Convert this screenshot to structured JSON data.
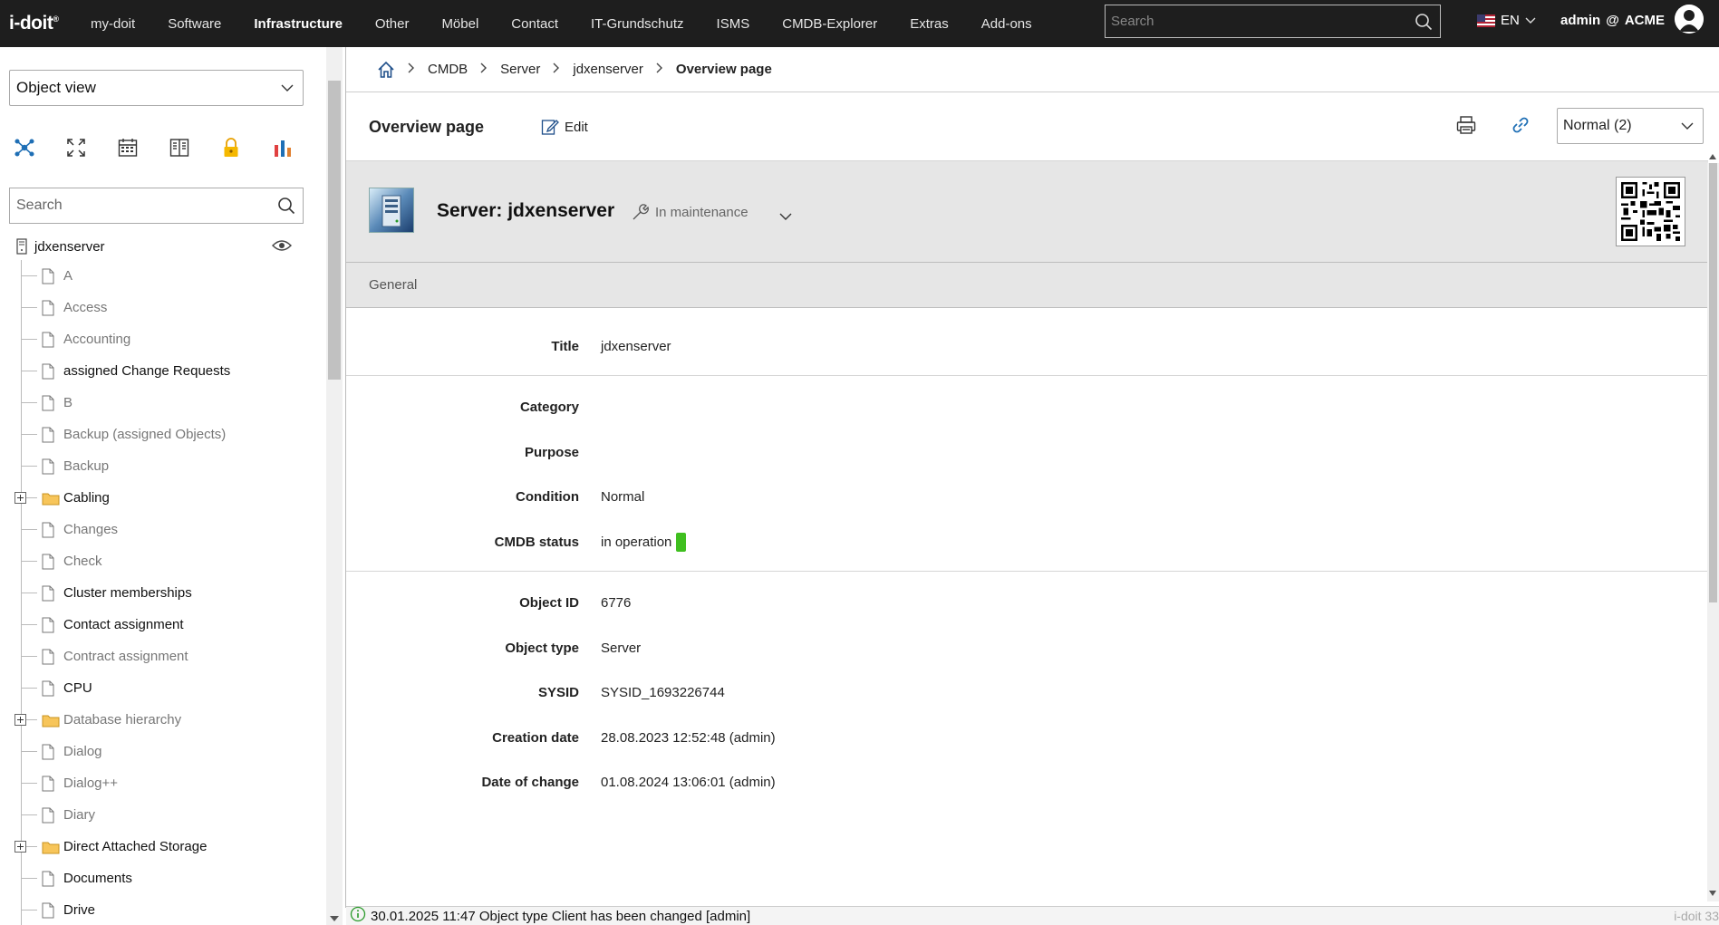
{
  "app": {
    "logo": "i-doit",
    "logo_mark": "®"
  },
  "topnav": {
    "items": [
      {
        "label": "my-doit",
        "active": false
      },
      {
        "label": "Software",
        "active": false
      },
      {
        "label": "Infrastructure",
        "active": true
      },
      {
        "label": "Other",
        "active": false
      },
      {
        "label": "Möbel",
        "active": false
      },
      {
        "label": "Contact",
        "active": false
      },
      {
        "label": "IT-Grundschutz",
        "active": false
      },
      {
        "label": "ISMS",
        "active": false
      },
      {
        "label": "CMDB-Explorer",
        "active": false
      },
      {
        "label": "Extras",
        "active": false
      },
      {
        "label": "Add-ons",
        "active": false
      }
    ],
    "search_placeholder": "Search",
    "language": "EN",
    "user": "admin",
    "user_sep": "@",
    "tenant": "ACME"
  },
  "sidebar": {
    "view_select": "Object view",
    "search_placeholder": "Search",
    "tools": [
      "network-icon",
      "expand-icon",
      "calendar-icon",
      "book-icon",
      "lock-icon",
      "bar-chart-icon"
    ],
    "root": "jdxenserver",
    "items": [
      {
        "label": "A",
        "type": "file",
        "muted": true
      },
      {
        "label": "Access",
        "type": "file",
        "muted": true
      },
      {
        "label": "Accounting",
        "type": "file",
        "muted": true
      },
      {
        "label": "assigned Change Requests",
        "type": "file",
        "muted": false
      },
      {
        "label": "B",
        "type": "file",
        "muted": true
      },
      {
        "label": "Backup (assigned Objects)",
        "type": "file",
        "muted": true
      },
      {
        "label": "Backup",
        "type": "file",
        "muted": true
      },
      {
        "label": "Cabling",
        "type": "folder",
        "muted": false
      },
      {
        "label": "Changes",
        "type": "file",
        "muted": true
      },
      {
        "label": "Check",
        "type": "file",
        "muted": true
      },
      {
        "label": "Cluster memberships",
        "type": "file",
        "muted": false
      },
      {
        "label": "Contact assignment",
        "type": "file",
        "muted": false
      },
      {
        "label": "Contract assignment",
        "type": "file",
        "muted": true
      },
      {
        "label": "CPU",
        "type": "file",
        "muted": false
      },
      {
        "label": "Database hierarchy",
        "type": "folder",
        "muted": true
      },
      {
        "label": "Dialog",
        "type": "file",
        "muted": true
      },
      {
        "label": "Dialog++",
        "type": "file",
        "muted": true
      },
      {
        "label": "Diary",
        "type": "file",
        "muted": true
      },
      {
        "label": "Direct Attached Storage",
        "type": "folder",
        "muted": false
      },
      {
        "label": "Documents",
        "type": "file",
        "muted": false
      },
      {
        "label": "Drive",
        "type": "file",
        "muted": false
      }
    ]
  },
  "breadcrumb": {
    "items": [
      "CMDB",
      "Server",
      "jdxenserver"
    ],
    "current": "Overview page"
  },
  "titlebar": {
    "title": "Overview page",
    "edit_label": "Edit",
    "status_select": "Normal (2)"
  },
  "object": {
    "title": "Server: jdxenserver",
    "state": "In maintenance",
    "section": "General",
    "fields": [
      {
        "key": "Title",
        "value": "jdxenserver"
      },
      {
        "key": "Category",
        "value": ""
      },
      {
        "key": "Purpose",
        "value": ""
      },
      {
        "key": "Condition",
        "value": "Normal"
      },
      {
        "key": "CMDB status",
        "value": "in operation",
        "status_color": "#3fbf1f"
      },
      {
        "key": "Object ID",
        "value": "6776"
      },
      {
        "key": "Object type",
        "value": "Server"
      },
      {
        "key": "SYSID",
        "value": "SYSID_1693226744"
      },
      {
        "key": "Creation date",
        "value": "28.08.2023 12:52:48 (admin)"
      },
      {
        "key": "Date of change",
        "value": "01.08.2024 13:06:01 (admin)"
      }
    ]
  },
  "footer": {
    "message": "30.01.2025 11:47 Object type Client has been changed [admin]",
    "version": "i-doit 33"
  },
  "colors": {
    "topbar": "#1e1e1e",
    "header_bg": "#e6e6e6",
    "accent": "#1f6fb5",
    "status_green": "#3fbf1f"
  }
}
